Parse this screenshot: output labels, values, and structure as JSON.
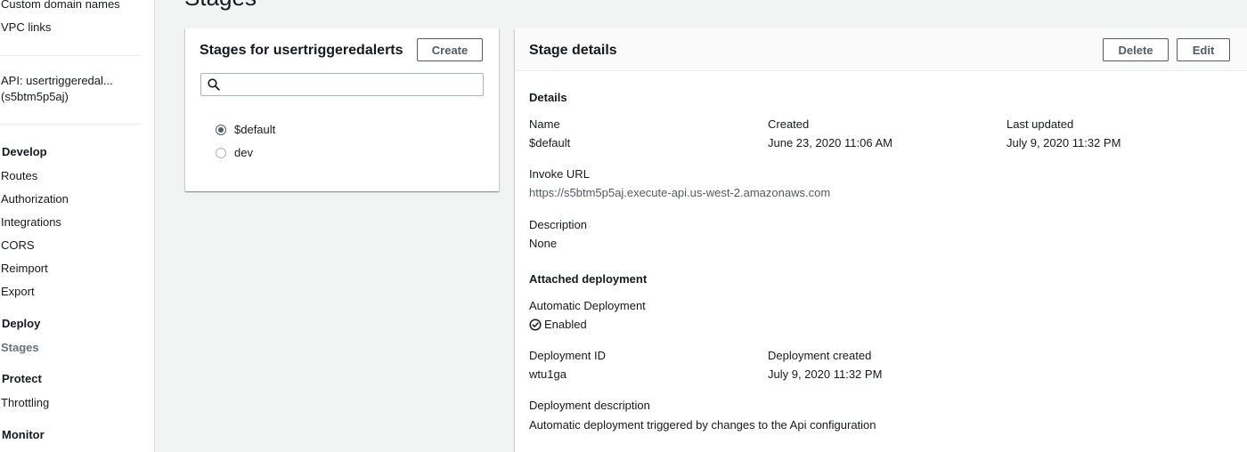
{
  "sidebar": {
    "top_items": [
      "Custom domain names",
      "VPC links"
    ],
    "api_label": "API: usertriggeredal...",
    "api_id": "(s5btm5p5aj)",
    "sections": {
      "develop": "Develop",
      "deploy": "Deploy",
      "protect": "Protect",
      "monitor": "Monitor"
    },
    "develop_items": [
      "Routes",
      "Authorization",
      "Integrations",
      "CORS",
      "Reimport",
      "Export"
    ],
    "deploy_items": [
      "Stages"
    ],
    "protect_items": [
      "Throttling"
    ],
    "active_item": "Stages"
  },
  "page": {
    "title": "Stages"
  },
  "stages_panel": {
    "title": "Stages for usertriggeredalerts",
    "create_label": "Create",
    "search_placeholder": "",
    "search_icon": "search-icon",
    "stages": [
      {
        "name": "$default",
        "selected": true
      },
      {
        "name": "dev",
        "selected": false
      }
    ]
  },
  "details_panel": {
    "title": "Stage details",
    "delete_label": "Delete",
    "edit_label": "Edit",
    "details_heading": "Details",
    "name_label": "Name",
    "name_value": "$default",
    "created_label": "Created",
    "created_value": "June 23, 2020 11:06 AM",
    "updated_label": "Last updated",
    "updated_value": "July 9, 2020 11:32 PM",
    "invoke_label": "Invoke URL",
    "invoke_value": "https://s5btm5p5aj.execute-api.us-west-2.amazonaws.com",
    "description_label": "Description",
    "description_value": "None",
    "deployment_heading": "Attached deployment",
    "auto_deploy_label": "Automatic Deployment",
    "auto_deploy_value": "Enabled",
    "auto_deploy_icon": "check-circle-icon",
    "deployment_id_label": "Deployment ID",
    "deployment_id_value": "wtu1ga",
    "deployment_created_label": "Deployment created",
    "deployment_created_value": "July 9, 2020 11:32 PM",
    "deployment_desc_label": "Deployment description",
    "deployment_desc_value": "Automatic deployment triggered by changes to the Api configuration"
  }
}
